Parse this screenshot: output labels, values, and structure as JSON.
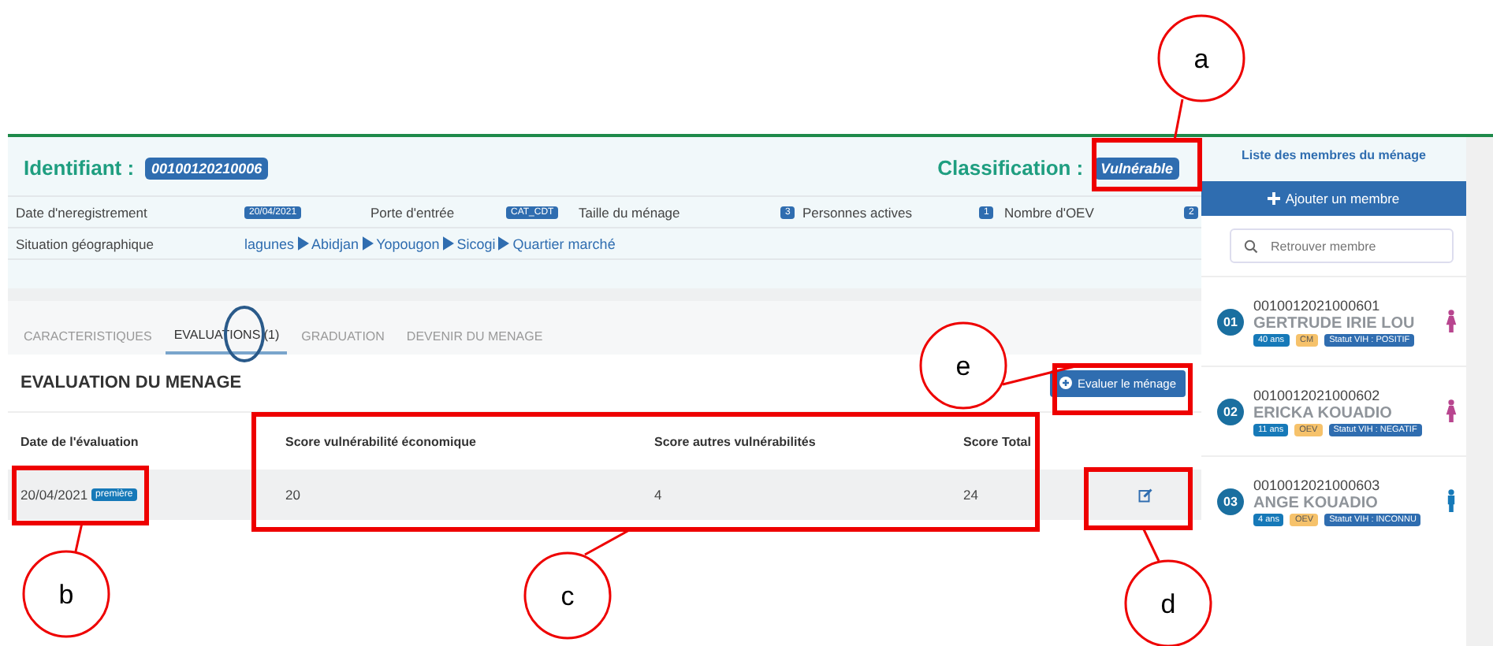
{
  "header": {
    "identifier_label": "Identifiant :",
    "identifier": "00100120210006",
    "classification_label": "Classification :",
    "classification": "Vulnérable"
  },
  "info": {
    "fields": [
      {
        "label": "Date d'neregistrement",
        "value": "20/04/2021"
      },
      {
        "label": "Porte d'entrée",
        "value": "CAT_CDT"
      },
      {
        "label": "Taille du ménage",
        "value": "3"
      },
      {
        "label": "Personnes actives",
        "value": "1"
      },
      {
        "label": "Nombre d'OEV",
        "value": "2"
      }
    ],
    "location_label": "Situation géographique",
    "location": [
      "lagunes",
      "Abidjan",
      "Yopougon",
      "Sicogi",
      "Quartier marché"
    ]
  },
  "tabs": [
    {
      "label": "CARACTERISTIQUES",
      "selected": false
    },
    {
      "label": "EVALUATIONS (1)",
      "selected": true
    },
    {
      "label": "GRADUATION",
      "selected": false
    },
    {
      "label": "DEVENIR DU MENAGE",
      "selected": false
    }
  ],
  "section": {
    "title": "EVALUATION DU MENAGE",
    "button": "Evaluer le ménage"
  },
  "table": {
    "columns": [
      "Date de l'évaluation",
      "Score vulnérabilité économique",
      "Score autres vulnérabilités",
      "Score Total"
    ],
    "rows": [
      {
        "tag": "première",
        "cells": [
          "20/04/2021",
          "20",
          "4",
          "24"
        ]
      }
    ]
  },
  "sidebar": {
    "title": "Liste des membres du ménage",
    "add_button": "Ajouter un membre",
    "search": {
      "placeholder": "Retrouver membre"
    },
    "members": [
      {
        "number": "01",
        "id": "0010012021000601",
        "name": "GERTRUDE IRIE LOU",
        "age": "40 ans",
        "role": "CM",
        "status": "Statut VIH : POSITIF",
        "kind": "female"
      },
      {
        "number": "02",
        "id": "0010012021000602",
        "name": "ERICKA KOUADIO",
        "age": "11 ans",
        "role": "OEV",
        "status": "Statut VIH : NEGATIF",
        "kind": "female"
      },
      {
        "number": "03",
        "id": "0010012021000603",
        "name": "ANGE KOUADIO",
        "age": "4 ans",
        "role": "OEV",
        "status": "Statut VIH : INCONNU",
        "kind": "male"
      }
    ]
  },
  "callouts": [
    {
      "label": "a"
    },
    {
      "label": "e"
    },
    {
      "label": "b"
    },
    {
      "label": "c"
    },
    {
      "label": "d"
    }
  ]
}
